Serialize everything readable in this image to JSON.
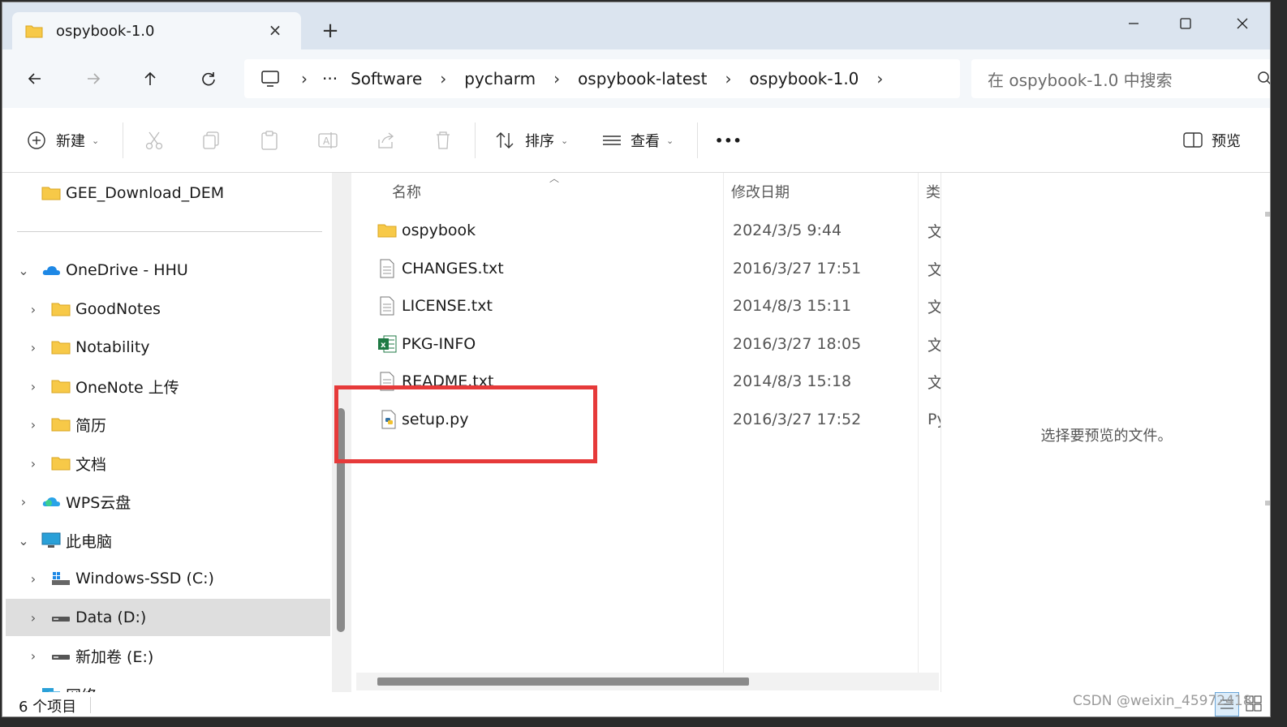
{
  "tab": {
    "title": "ospybook-1.0",
    "close_icon": "×",
    "new_tab_icon": "+"
  },
  "window_controls": {
    "minimize": "minimize-icon",
    "maximize": "maximize-icon",
    "close": "close-icon"
  },
  "nav": {
    "back": "back-arrow-icon",
    "forward": "forward-arrow-icon",
    "up": "up-arrow-icon",
    "refresh": "refresh-icon"
  },
  "address": {
    "ellipsis": "···",
    "sep": "›",
    "crumbs": [
      "Software",
      "pycharm",
      "ospybook-latest",
      "ospybook-1.0"
    ]
  },
  "search": {
    "placeholder": "在 ospybook-1.0 中搜索"
  },
  "toolbar": {
    "new_label": "新建",
    "sort_label": "排序",
    "view_label": "查看",
    "more_label": "•••",
    "preview_label": "预览",
    "chevron": "⌄"
  },
  "sidebar": {
    "expander_right": "›",
    "expander_down": "⌄",
    "items": [
      {
        "label": "GEE_Download_DEM"
      },
      {
        "label": "OneDrive - HHU"
      },
      {
        "label": "GoodNotes"
      },
      {
        "label": "Notability"
      },
      {
        "label": "OneNote 上传"
      },
      {
        "label": "简历"
      },
      {
        "label": "文档"
      },
      {
        "label": "WPS云盘"
      },
      {
        "label": "此电脑"
      },
      {
        "label": "Windows-SSD (C:)"
      },
      {
        "label": "Data (D:)"
      },
      {
        "label": "新加卷 (E:)"
      },
      {
        "label": "网络"
      }
    ]
  },
  "columns": {
    "name": "名称",
    "date": "修改日期",
    "type": "类"
  },
  "files": [
    {
      "name": "ospybook",
      "date": "2024/3/5 9:44",
      "type": "文",
      "icon": "folder-icon"
    },
    {
      "name": "CHANGES.txt",
      "date": "2016/3/27 17:51",
      "type": "文",
      "icon": "text-file-icon"
    },
    {
      "name": "LICENSE.txt",
      "date": "2014/8/3 15:11",
      "type": "文",
      "icon": "text-file-icon"
    },
    {
      "name": "PKG-INFO",
      "date": "2016/3/27 18:05",
      "type": "文",
      "icon": "excel-file-icon"
    },
    {
      "name": "README.txt",
      "date": "2014/8/3 15:18",
      "type": "文",
      "icon": "text-file-icon"
    },
    {
      "name": "setup.py",
      "date": "2016/3/27 17:52",
      "type": "Py",
      "icon": "python-file-icon"
    }
  ],
  "preview": {
    "empty_text": "选择要预览的文件。"
  },
  "status": {
    "count": "6 个项目"
  },
  "watermark": "CSDN @weixin_45972418",
  "colors": {
    "folder": "#f7c948",
    "highlight": "#e63a3a",
    "accent": "#0067c0"
  }
}
